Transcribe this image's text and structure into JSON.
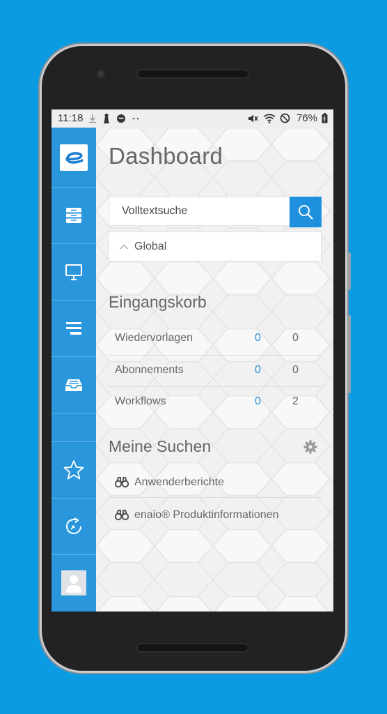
{
  "status_bar": {
    "time": "11:18",
    "left_icons": [
      "download-icon",
      "chess-pawn-icon",
      "face-icon",
      "more-dots-icon"
    ],
    "right_icons": [
      "mute-icon",
      "wifi-icon",
      "dnd-icon"
    ],
    "battery": "76%"
  },
  "sidebar": {
    "items": [
      {
        "name": "logo",
        "icon": "enaio-logo-icon"
      },
      {
        "name": "archive",
        "icon": "cabinet-icon"
      },
      {
        "name": "presentation",
        "icon": "monitor-icon"
      },
      {
        "name": "lists",
        "icon": "list-icon"
      },
      {
        "name": "inbox",
        "icon": "inbox-tray-icon"
      },
      {
        "name": "favorites",
        "icon": "star-icon"
      },
      {
        "name": "recent",
        "icon": "history-icon"
      },
      {
        "name": "user",
        "icon": "user-avatar-icon"
      }
    ]
  },
  "main": {
    "title": "Dashboard",
    "search": {
      "placeholder": "Volltextsuche",
      "scope_label": "Global"
    },
    "inbox": {
      "title": "Eingangskorb",
      "rows": [
        {
          "label": "Wiedervorlagen",
          "new": "0",
          "total": "0"
        },
        {
          "label": "Abonnements",
          "new": "0",
          "total": "0"
        },
        {
          "label": "Workflows",
          "new": "0",
          "total": "2"
        }
      ]
    },
    "my_searches": {
      "title": "Meine Suchen",
      "items": [
        "Anwenderberichte",
        "enaio® Produktinformationen"
      ]
    }
  },
  "colors": {
    "background": "#0a9be3",
    "sidebar": "#2a96dc",
    "accent": "#1e90dd",
    "count_blue": "#2a8fd6"
  }
}
